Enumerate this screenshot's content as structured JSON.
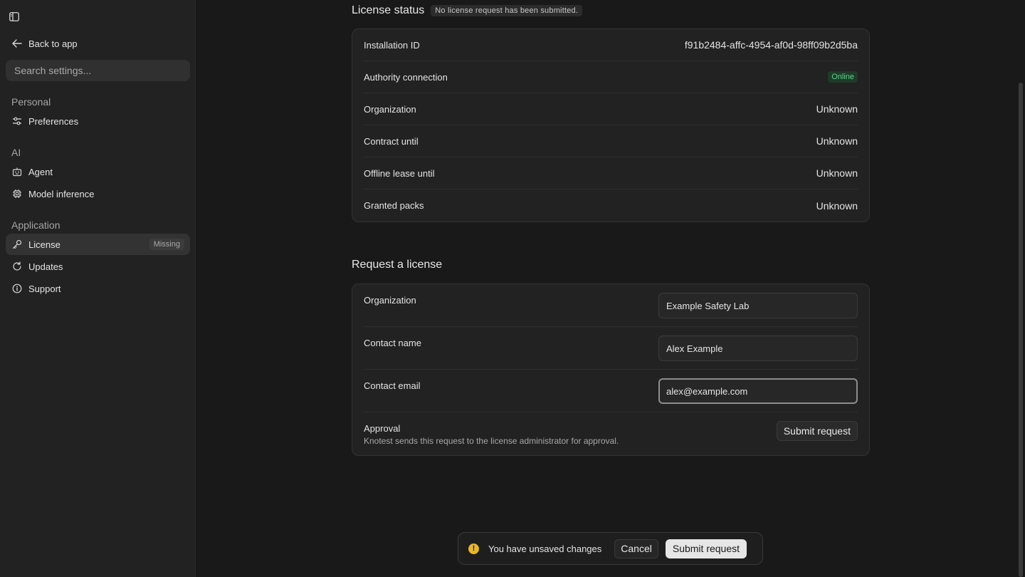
{
  "sidebar": {
    "back_label": "Back to app",
    "search_placeholder": "Search settings...",
    "sections": {
      "personal": "Personal",
      "ai": "AI",
      "application": "Application"
    },
    "items": {
      "preferences": "Preferences",
      "agent": "Agent",
      "model_inference": "Model inference",
      "license": "License",
      "license_badge": "Missing",
      "updates": "Updates",
      "support": "Support"
    }
  },
  "license_status": {
    "heading": "License status",
    "chip": "No license request has been submitted.",
    "rows": [
      {
        "label": "Installation ID",
        "value": "f91b2484-affc-4954-af0d-98ff09b2d5ba"
      },
      {
        "label": "Authority connection",
        "value": "Online"
      },
      {
        "label": "Organization",
        "value": "Unknown"
      },
      {
        "label": "Contract until",
        "value": "Unknown"
      },
      {
        "label": "Offline lease until",
        "value": "Unknown"
      },
      {
        "label": "Granted packs",
        "value": "Unknown"
      }
    ]
  },
  "request": {
    "heading": "Request a license",
    "organization_label": "Organization",
    "organization_value": "Example Safety Lab",
    "contact_name_label": "Contact name",
    "contact_name_value": "Alex Example",
    "contact_email_label": "Contact email",
    "contact_email_value": "alex@example.com",
    "approval_label": "Approval",
    "approval_desc": "Knotest sends this request to the license administrator for approval.",
    "submit_label": "Submit request"
  },
  "toast": {
    "message": "You have unsaved changes",
    "cancel_label": "Cancel",
    "submit_label": "Submit request"
  },
  "colors": {
    "background": "#191919",
    "sidebar": "#222222",
    "online": "#5fd38b",
    "warning": "#e8b829"
  }
}
